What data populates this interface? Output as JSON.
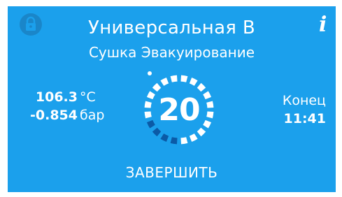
{
  "colors": {
    "background": "#1ba0ec",
    "text": "#ffffff",
    "progress_done": "#0b5aa6",
    "lock_circle": "#1a86c9"
  },
  "header": {
    "title": "Универсальная В",
    "subtitle": "Сушка Эвакуирование",
    "lock_icon": "lock-icon",
    "info_icon": "info-icon",
    "info_label": "i"
  },
  "readings": {
    "temperature": {
      "value": "106.3",
      "unit": "°C"
    },
    "pressure": {
      "value": "-0.854",
      "unit": "бар"
    }
  },
  "timer": {
    "value": "20",
    "progress": 0.2
  },
  "end": {
    "label": "Конец",
    "time": "11:41"
  },
  "actions": {
    "finish_label": "ЗАВЕРШИТЬ"
  }
}
